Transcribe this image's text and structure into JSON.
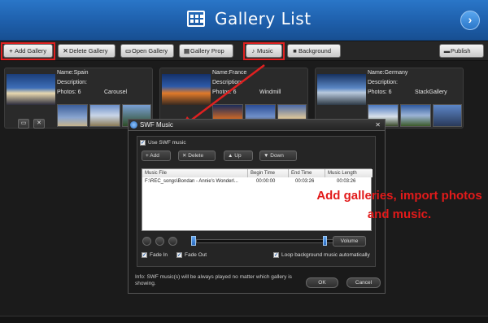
{
  "header": {
    "title": "Gallery List"
  },
  "toolbar": {
    "add_gallery": "Add Gallery",
    "delete_gallery": "Delete Gallery",
    "open_gallery": "Open Gallery",
    "gallery_prop": "Gallery Prop",
    "music": "Music",
    "background": "Background",
    "publish": "Publish"
  },
  "galleries": [
    {
      "name": "Name:Spain",
      "description": "Description:",
      "photos": "Photos: 6",
      "template": "Carousel"
    },
    {
      "name": "Name:France",
      "description": "Description:",
      "photos": "Photos: 6",
      "template": "Windmill"
    },
    {
      "name": "Name:Germany",
      "description": "Description:",
      "photos": "Photos: 6",
      "template": "StackGallery"
    }
  ],
  "dialog": {
    "title": "SWF Music",
    "use_swf_music": "Use SWF music",
    "buttons": {
      "add": "Add",
      "delete": "Delete",
      "up": "Up",
      "down": "Down"
    },
    "columns": [
      "Music File",
      "Begin Time",
      "End Time",
      "Music Length"
    ],
    "rows": [
      {
        "file": "F:\\REC_songs\\Bondan - Annie's Wonderl...",
        "begin": "00:00:00",
        "end": "00:03:26",
        "length": "00:03:26"
      }
    ],
    "volume": "Volume",
    "fade_in": "Fade In",
    "fade_out": "Fade Out",
    "loop": "Loop background music automatically",
    "info": "Info: SWF music(s) will be always played no matter which gallery is showing.",
    "ok": "OK",
    "cancel": "Cancel"
  },
  "annotation": "Add  galleries, import photos and music.",
  "colors": {
    "header_blue": "#1e5fab",
    "highlight_red": "#e02020",
    "annotation_red": "#e21a1a"
  }
}
